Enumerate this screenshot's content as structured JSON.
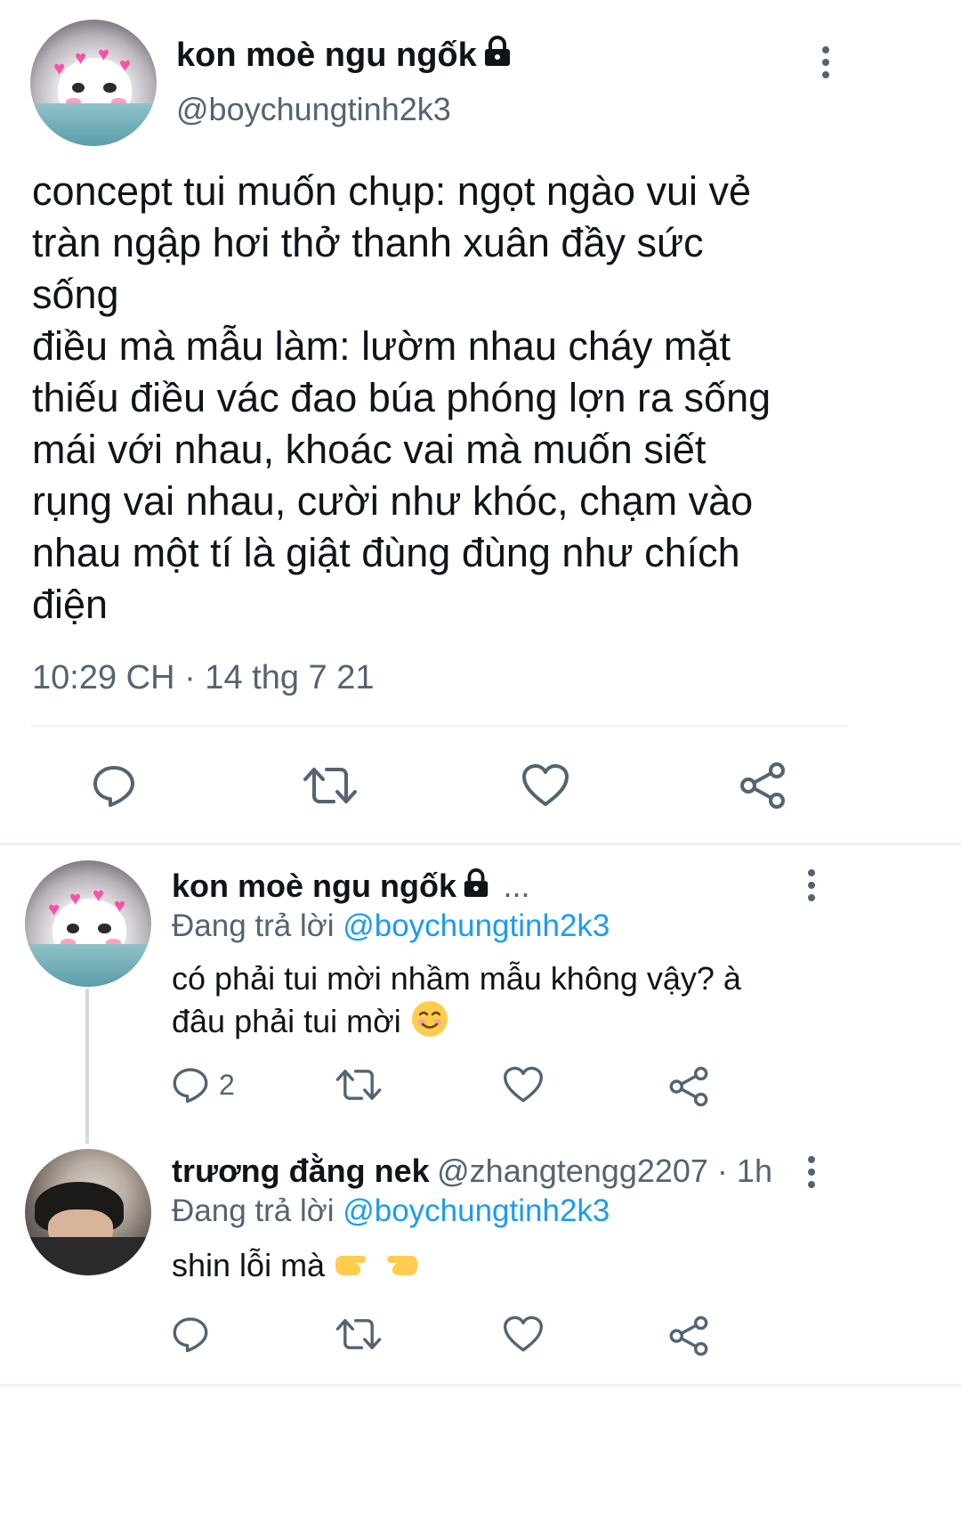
{
  "main_tweet": {
    "display_name": "kon moè ngu ngốk",
    "handle": "@boychungtinh2k3",
    "text": "concept tui muốn chụp: ngọt ngào vui vẻ\ntràn ngập hơi thở thanh xuân đầy sức\nsống\nđiều mà mẫu làm: lườm nhau cháy mặt\nthiếu điều vác đao búa phóng lợn ra sống\nmái với nhau, khoác vai mà muốn siết\nrụng vai nhau, cười như khóc, chạm vào\nnhau một tí là giật đùng đùng như chích\nđiện",
    "timestamp": "10:29 CH · 14 thg 7 21",
    "icons": [
      "lock-icon",
      "more-vertical-icon",
      "reply-icon",
      "retweet-icon",
      "like-icon",
      "share-icon"
    ]
  },
  "replies": [
    {
      "display_name": "kon moè ngu ngốk",
      "meta": "...",
      "replying_prefix": "Đang trả lời",
      "replying_to": "@boychungtinh2k3",
      "text": "có phải tui mời nhầm mẫu không vậy? à đâu phải tui mời",
      "reply_count": "2"
    },
    {
      "display_name": "trương đằng nek",
      "meta": "@zhangtengg2207 · 1h",
      "replying_prefix": "Đang trả lời",
      "replying_to": "@boychungtinh2k3",
      "text": "shin lỗi mà"
    }
  ],
  "colors": {
    "text": "#0f1419",
    "secondary": "#536471",
    "link": "#1d9bf0",
    "divider": "#eff3f4"
  }
}
